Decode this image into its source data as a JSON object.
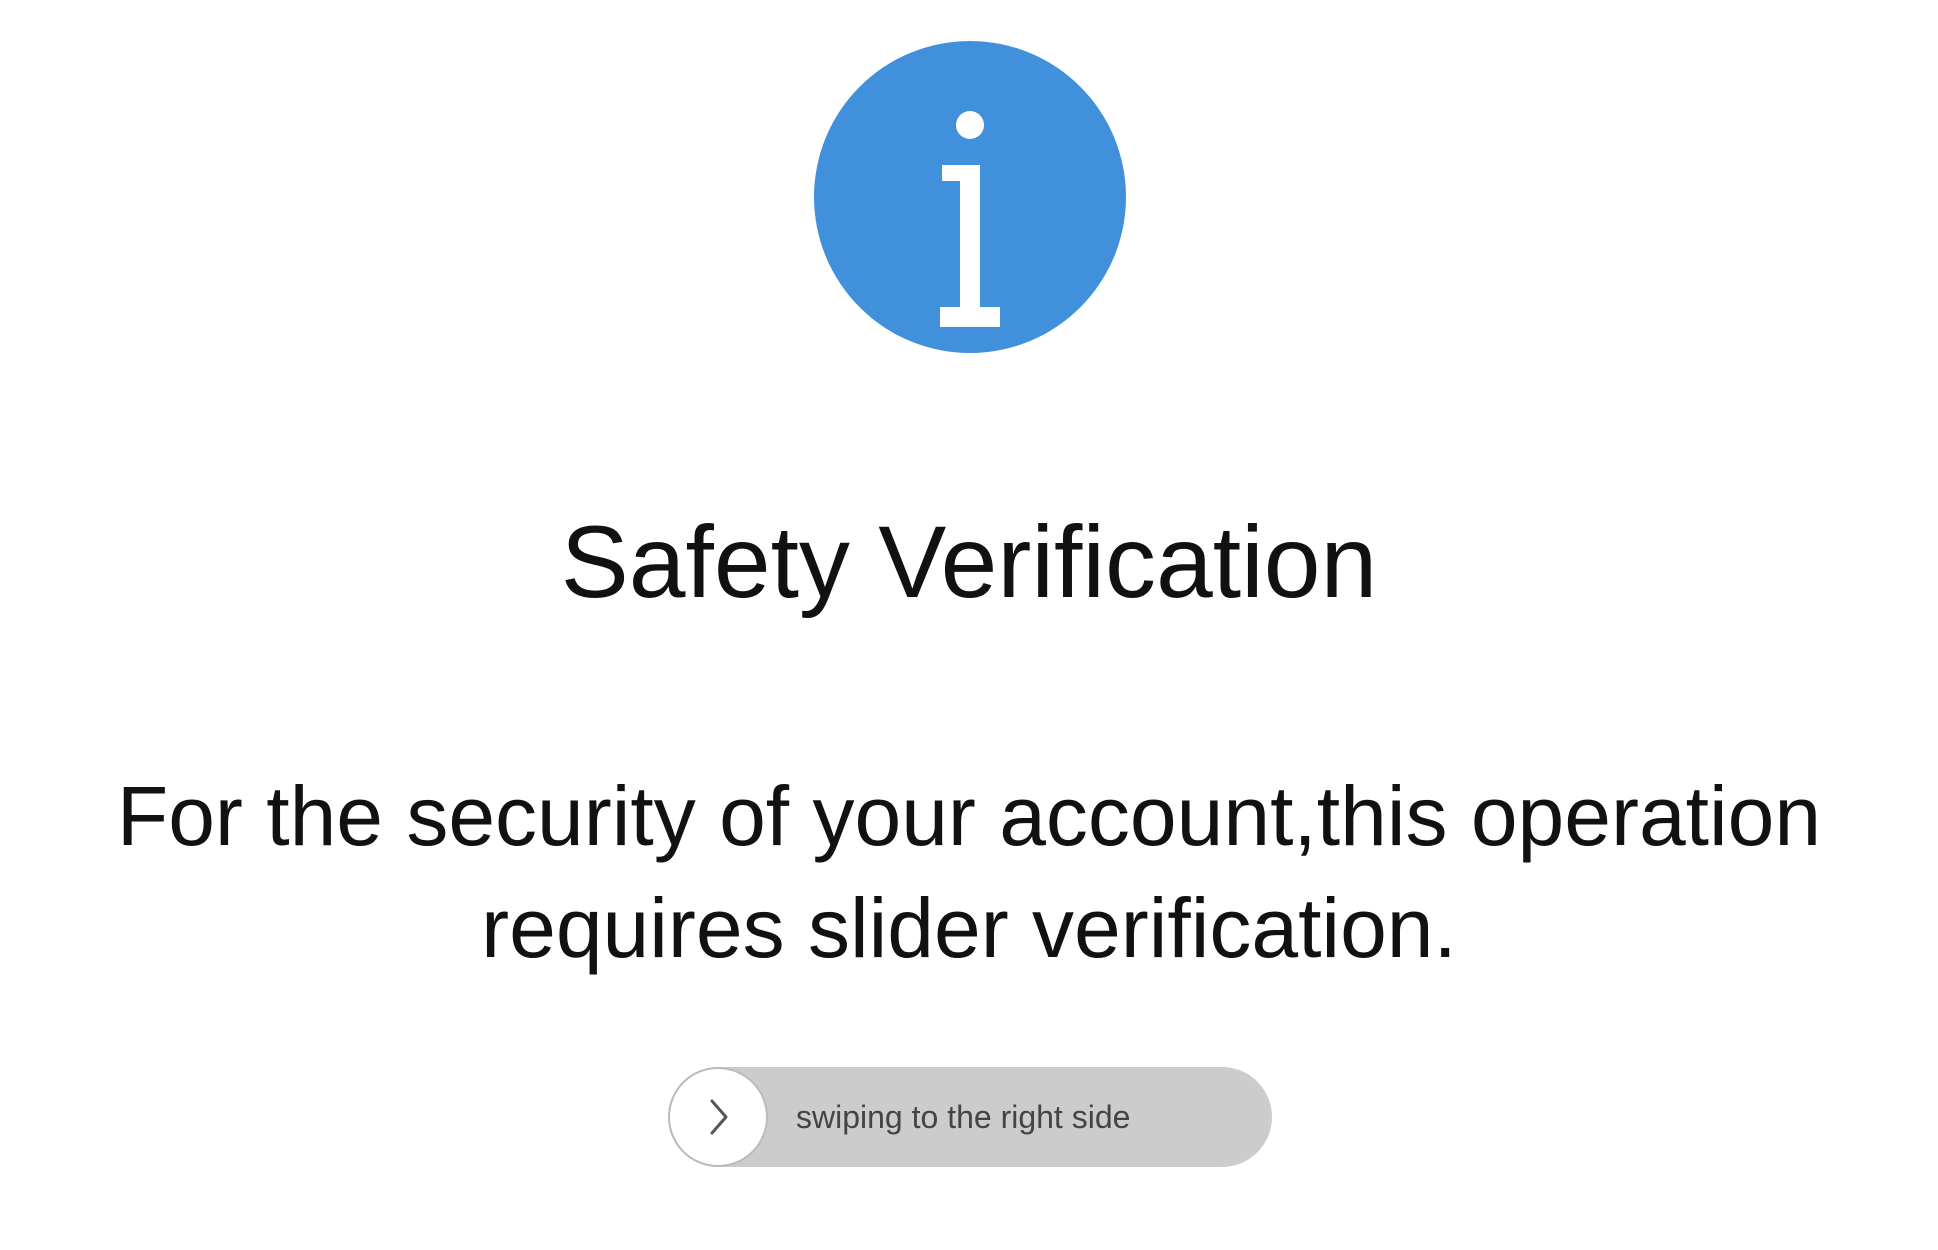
{
  "icon": {
    "name": "info-icon",
    "background_color": "#4190dc",
    "glyph_color": "#ffffff"
  },
  "dialog": {
    "title": "Safety Verification",
    "message_line1": "For the security of your account,this operation",
    "message_line2": "requires slider verification."
  },
  "slider": {
    "handle_icon": "chevron-right-icon",
    "label": "swiping to the right side",
    "track_color": "#cccccc",
    "progress": 0
  }
}
